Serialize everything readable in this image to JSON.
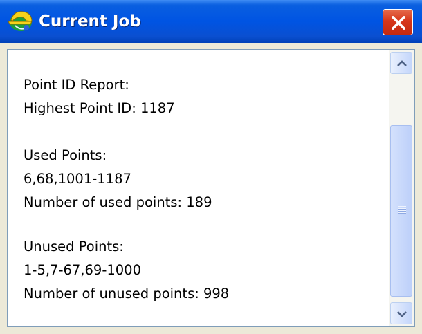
{
  "window": {
    "title": "Current Job",
    "close_label": "Close",
    "app_icon": "surveyor-helmet-icon"
  },
  "report": {
    "lines": [
      "Point ID Report:",
      "Highest Point ID: 1187",
      "Used Points:",
      "6,68,1001-1187",
      "Number of used points: 189",
      "Unused Points:",
      "1-5,7-67,69-1000",
      "Number of unused points: 998"
    ]
  },
  "scrollbar": {
    "up_icon": "chevron-up-icon",
    "down_icon": "chevron-down-icon",
    "grip_icon": "grip-icon"
  },
  "colors": {
    "titlebar": "#0054e3",
    "close_button": "#d6361a",
    "frame_border": "#7f9db9",
    "scrollbar_thumb": "#c4d6fb"
  }
}
